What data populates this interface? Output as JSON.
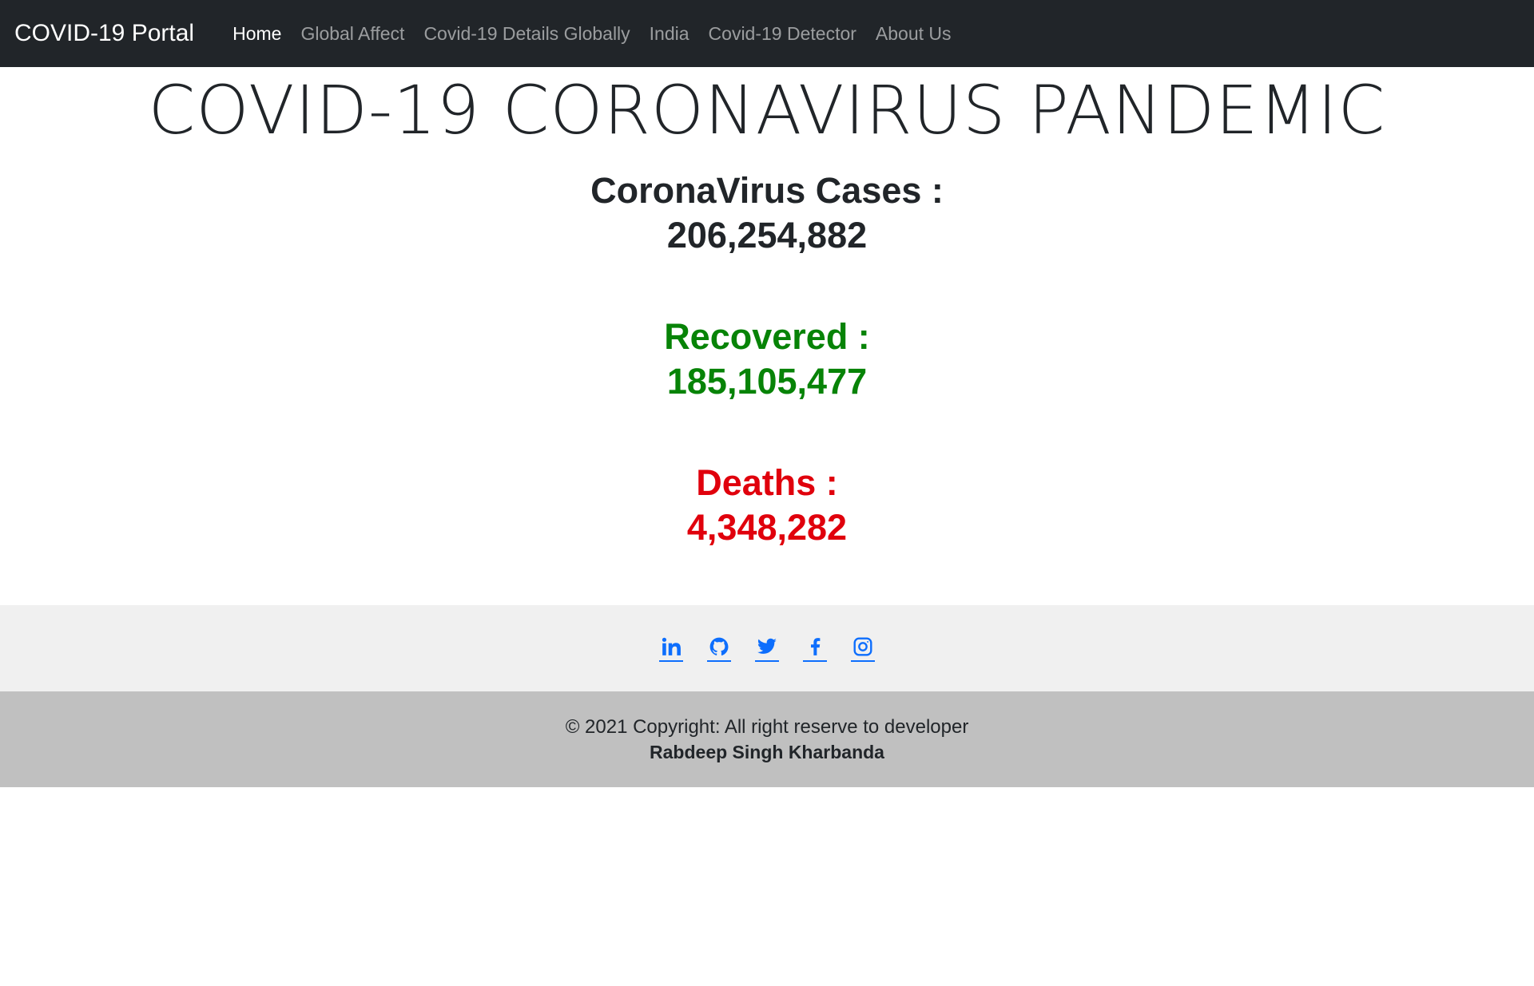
{
  "navbar": {
    "brand": "COVID-19 Portal",
    "links": [
      {
        "label": "Home",
        "active": true
      },
      {
        "label": "Global Affect",
        "active": false
      },
      {
        "label": "Covid-19 Details Globally",
        "active": false
      },
      {
        "label": "India",
        "active": false
      },
      {
        "label": "Covid-19 Detector",
        "active": false
      },
      {
        "label": "About Us",
        "active": false
      }
    ]
  },
  "main": {
    "title": "COVID-19 CORONAVIRUS PANDEMIC",
    "stats": {
      "cases": {
        "label": "CoronaVirus Cases :",
        "value": "206,254,882",
        "color": "#212529"
      },
      "recovered": {
        "label": "Recovered :",
        "value": "185,105,477",
        "color": "#078307"
      },
      "deaths": {
        "label": "Deaths :",
        "value": "4,348,282",
        "color": "#e0000c"
      }
    }
  },
  "footer": {
    "social_icons": [
      "linkedin-icon",
      "github-icon",
      "twitter-icon",
      "facebook-icon",
      "instagram-icon"
    ],
    "copyright": "© 2021 Copyright: All right reserve to developer",
    "developer": "Rabdeep Singh Kharbanda"
  },
  "colors": {
    "navbar_bg": "#212529",
    "link_blue": "#0d6efd",
    "social_bar_bg": "#f0f0f0",
    "copyright_bar_bg": "#c0c0c0"
  }
}
